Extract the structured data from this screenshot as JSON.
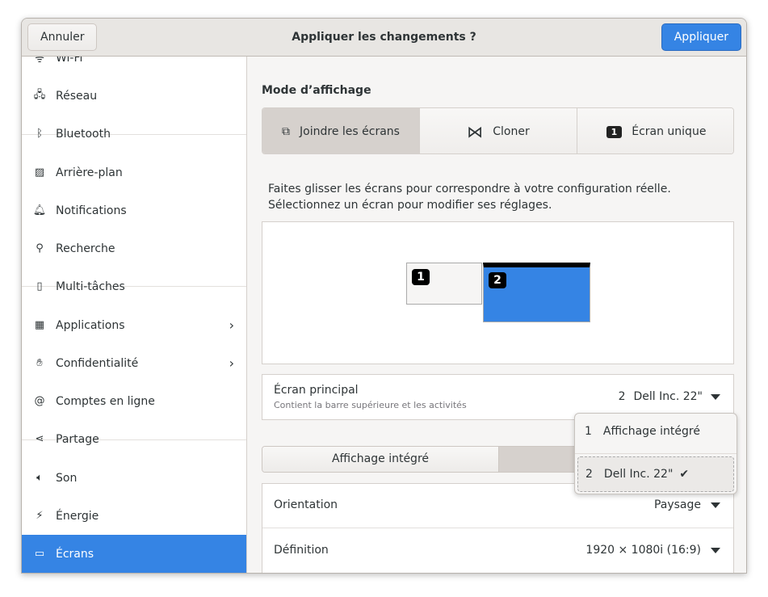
{
  "header": {
    "cancel": "Annuler",
    "title": "Appliquer les changements ?",
    "apply": "Appliquer",
    "accent": "#3584e4"
  },
  "sidebar": {
    "items": [
      {
        "label": "Wi-Fi",
        "icon": "wifi-icon"
      },
      {
        "label": "Réseau",
        "icon": "network-icon"
      },
      {
        "label": "Bluetooth",
        "icon": "bluetooth-icon"
      },
      {
        "label": "Arrière-plan",
        "icon": "background-icon"
      },
      {
        "label": "Notifications",
        "icon": "bell-icon"
      },
      {
        "label": "Recherche",
        "icon": "search-icon"
      },
      {
        "label": "Multi-tâches",
        "icon": "multitasking-icon"
      },
      {
        "label": "Applications",
        "icon": "apps-icon"
      },
      {
        "label": "Confidentialité",
        "icon": "hand-icon"
      },
      {
        "label": "Comptes en ligne",
        "icon": "at-icon"
      },
      {
        "label": "Partage",
        "icon": "share-icon"
      },
      {
        "label": "Son",
        "icon": "speaker-icon"
      },
      {
        "label": "Énergie",
        "icon": "power-icon"
      },
      {
        "label": "Écrans",
        "icon": "display-icon",
        "selected": true
      }
    ]
  },
  "main": {
    "mode_title": "Mode d’affichage",
    "modes": [
      {
        "label": "Joindre les écrans",
        "active": true
      },
      {
        "label": "Cloner"
      },
      {
        "label": "Écran unique"
      }
    ],
    "hint": "Faites glisser les écrans pour correspondre à votre configuration réelle. Sélectionnez un écran pour modifier ses réglages.",
    "monitors": [
      {
        "num": "1"
      },
      {
        "num": "2",
        "selected": true
      }
    ],
    "primary": {
      "label": "Écran principal",
      "sub": "Contient la barre supérieure et les activités",
      "num": "2",
      "value": "Dell Inc. 22\""
    },
    "popover": [
      {
        "num": "1",
        "label": "Affichage intégré"
      },
      {
        "num": "2",
        "label": "Dell Inc. 22\"",
        "checked": true
      }
    ],
    "tabs": [
      {
        "label": "Affichage intégré"
      },
      {
        "label": "Dell Inc. 22\"",
        "active": true
      }
    ],
    "orientation": {
      "label": "Orientation",
      "value": "Paysage"
    },
    "definition": {
      "label": "Définition",
      "value": "1920 × 1080i (16:9)"
    }
  }
}
